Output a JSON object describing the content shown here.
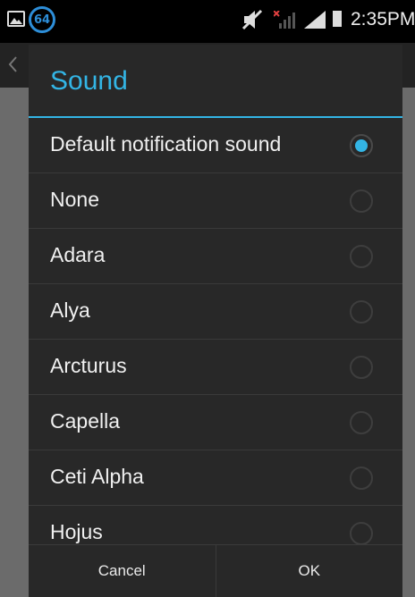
{
  "status_bar": {
    "notification_count": "64",
    "time": "2:35PM"
  },
  "dialog": {
    "title": "Sound",
    "options": [
      {
        "label": "Default notification sound",
        "selected": true
      },
      {
        "label": "None",
        "selected": false
      },
      {
        "label": "Adara",
        "selected": false
      },
      {
        "label": "Alya",
        "selected": false
      },
      {
        "label": "Arcturus",
        "selected": false
      },
      {
        "label": "Capella",
        "selected": false
      },
      {
        "label": "Ceti Alpha",
        "selected": false
      },
      {
        "label": "Hojus",
        "selected": false
      }
    ],
    "cancel_label": "Cancel",
    "ok_label": "OK"
  },
  "colors": {
    "accent": "#33b5e5",
    "dialog_bg": "#282828"
  }
}
